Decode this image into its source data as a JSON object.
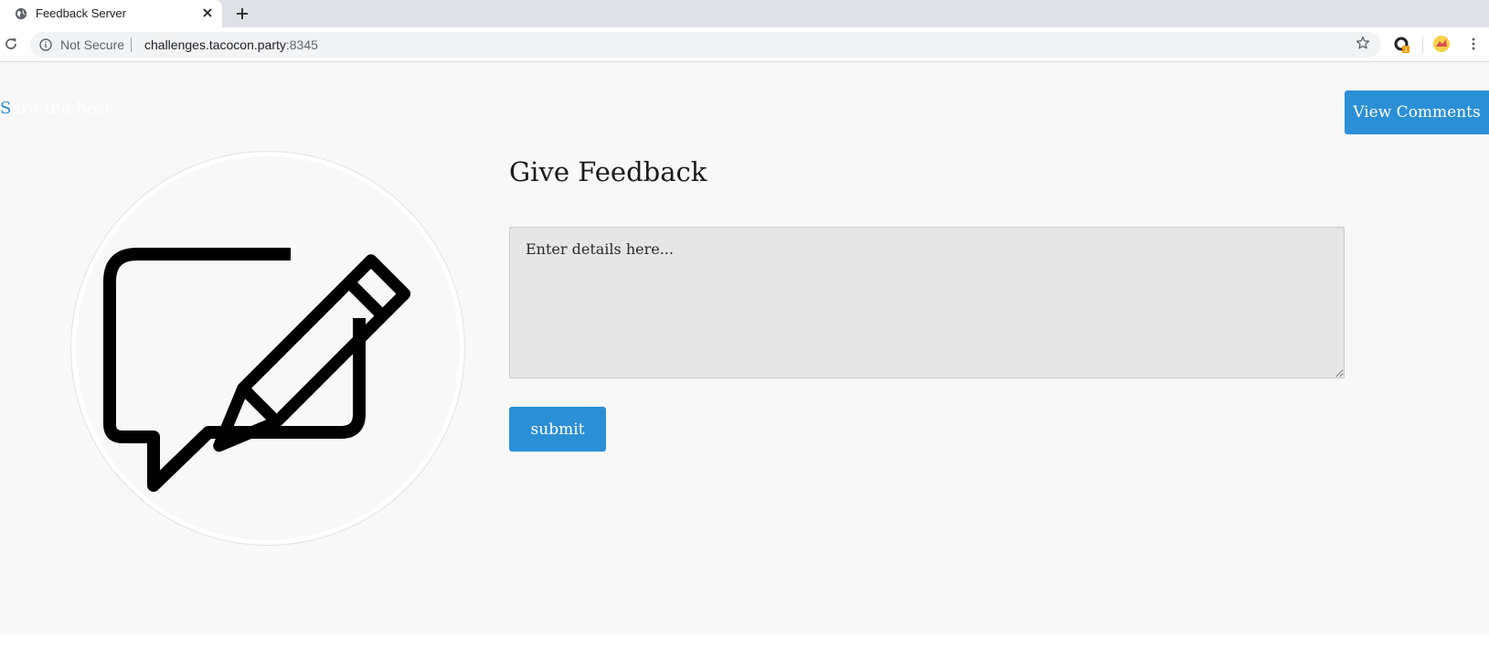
{
  "browser": {
    "tab_title": "Feedback Server",
    "security_label": "Not Secure",
    "url_host": "challenges.tacocon.party",
    "url_port": ":8345"
  },
  "header": {
    "brand_initial": "S",
    "brand_rest": "are the best",
    "view_comments_label": "View Comments"
  },
  "main": {
    "heading": "Give Feedback",
    "details_placeholder": "Enter details here...",
    "submit_label": "submit"
  },
  "icons": {
    "hero": "feedback-pencil-icon",
    "tab": "globe-icon",
    "security": "info-icon"
  },
  "colors": {
    "accent": "#2b8fd6",
    "page_background": "#f8f8f8",
    "textarea_background": "#e6e6e6"
  }
}
